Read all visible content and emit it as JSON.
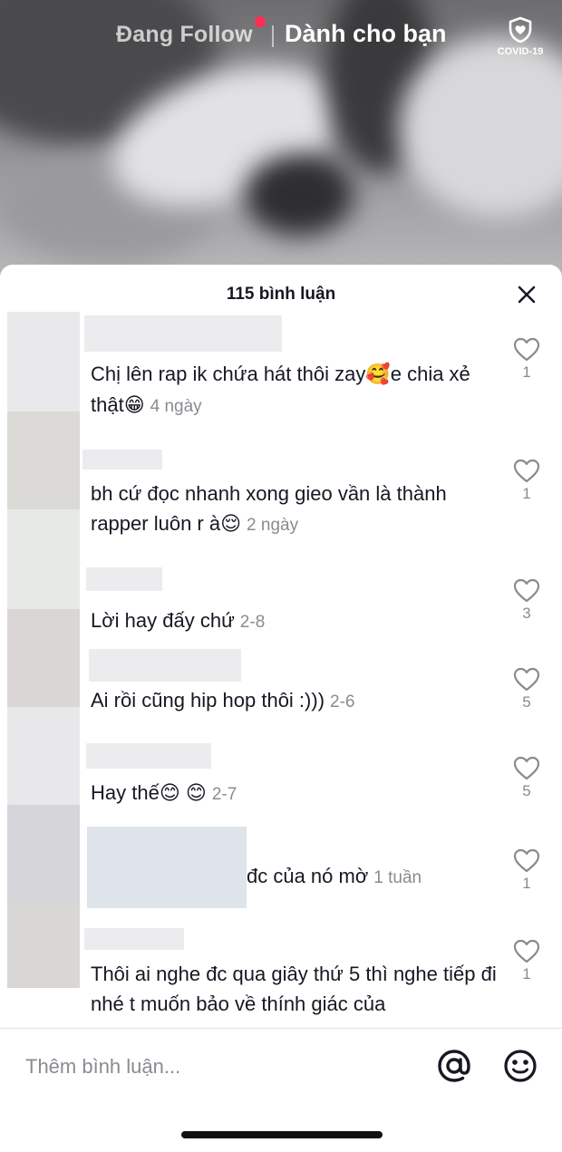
{
  "top_nav": {
    "following_label": "Đang Follow",
    "for_you_label": "Dành cho bạn",
    "covid_label": "COVID-19"
  },
  "comments_sheet": {
    "title": "115 bình luận",
    "comments": [
      {
        "text": "Chị lên rap ik chứa hát thôi zay",
        "emoji_1": "🥰",
        "text_2": "e chia xẻ thật",
        "emoji_2": "😁",
        "time": "4 ngày",
        "likes": "1"
      },
      {
        "text": "bh cứ đọc nhanh xong gieo vần là thành rapper luôn r à",
        "emoji_1": "😌",
        "time": "2 ngày",
        "likes": "1"
      },
      {
        "text": "Lời hay đấy chứ",
        "time": "2-8",
        "likes": "3"
      },
      {
        "text": "Ai rồi cũng hip hop thôi :)))",
        "time": "2-6",
        "likes": "5"
      },
      {
        "text": "Hay thế",
        "emoji_1": "😊",
        "emoji_2": "😊",
        "time": "2-7",
        "likes": "5"
      },
      {
        "text": "đc của nó mờ",
        "time": "1 tuần",
        "likes": "1"
      },
      {
        "text": "Thôi ai nghe đc qua giây thứ 5 thì nghe tiếp đi nhé t muốn bảo về thính giác của",
        "likes": "1"
      }
    ]
  },
  "input_bar": {
    "placeholder": "Thêm bình luận..."
  },
  "colors": {
    "accent": "#fe2c55",
    "text_primary": "#161823",
    "text_secondary": "#8a8b91"
  }
}
